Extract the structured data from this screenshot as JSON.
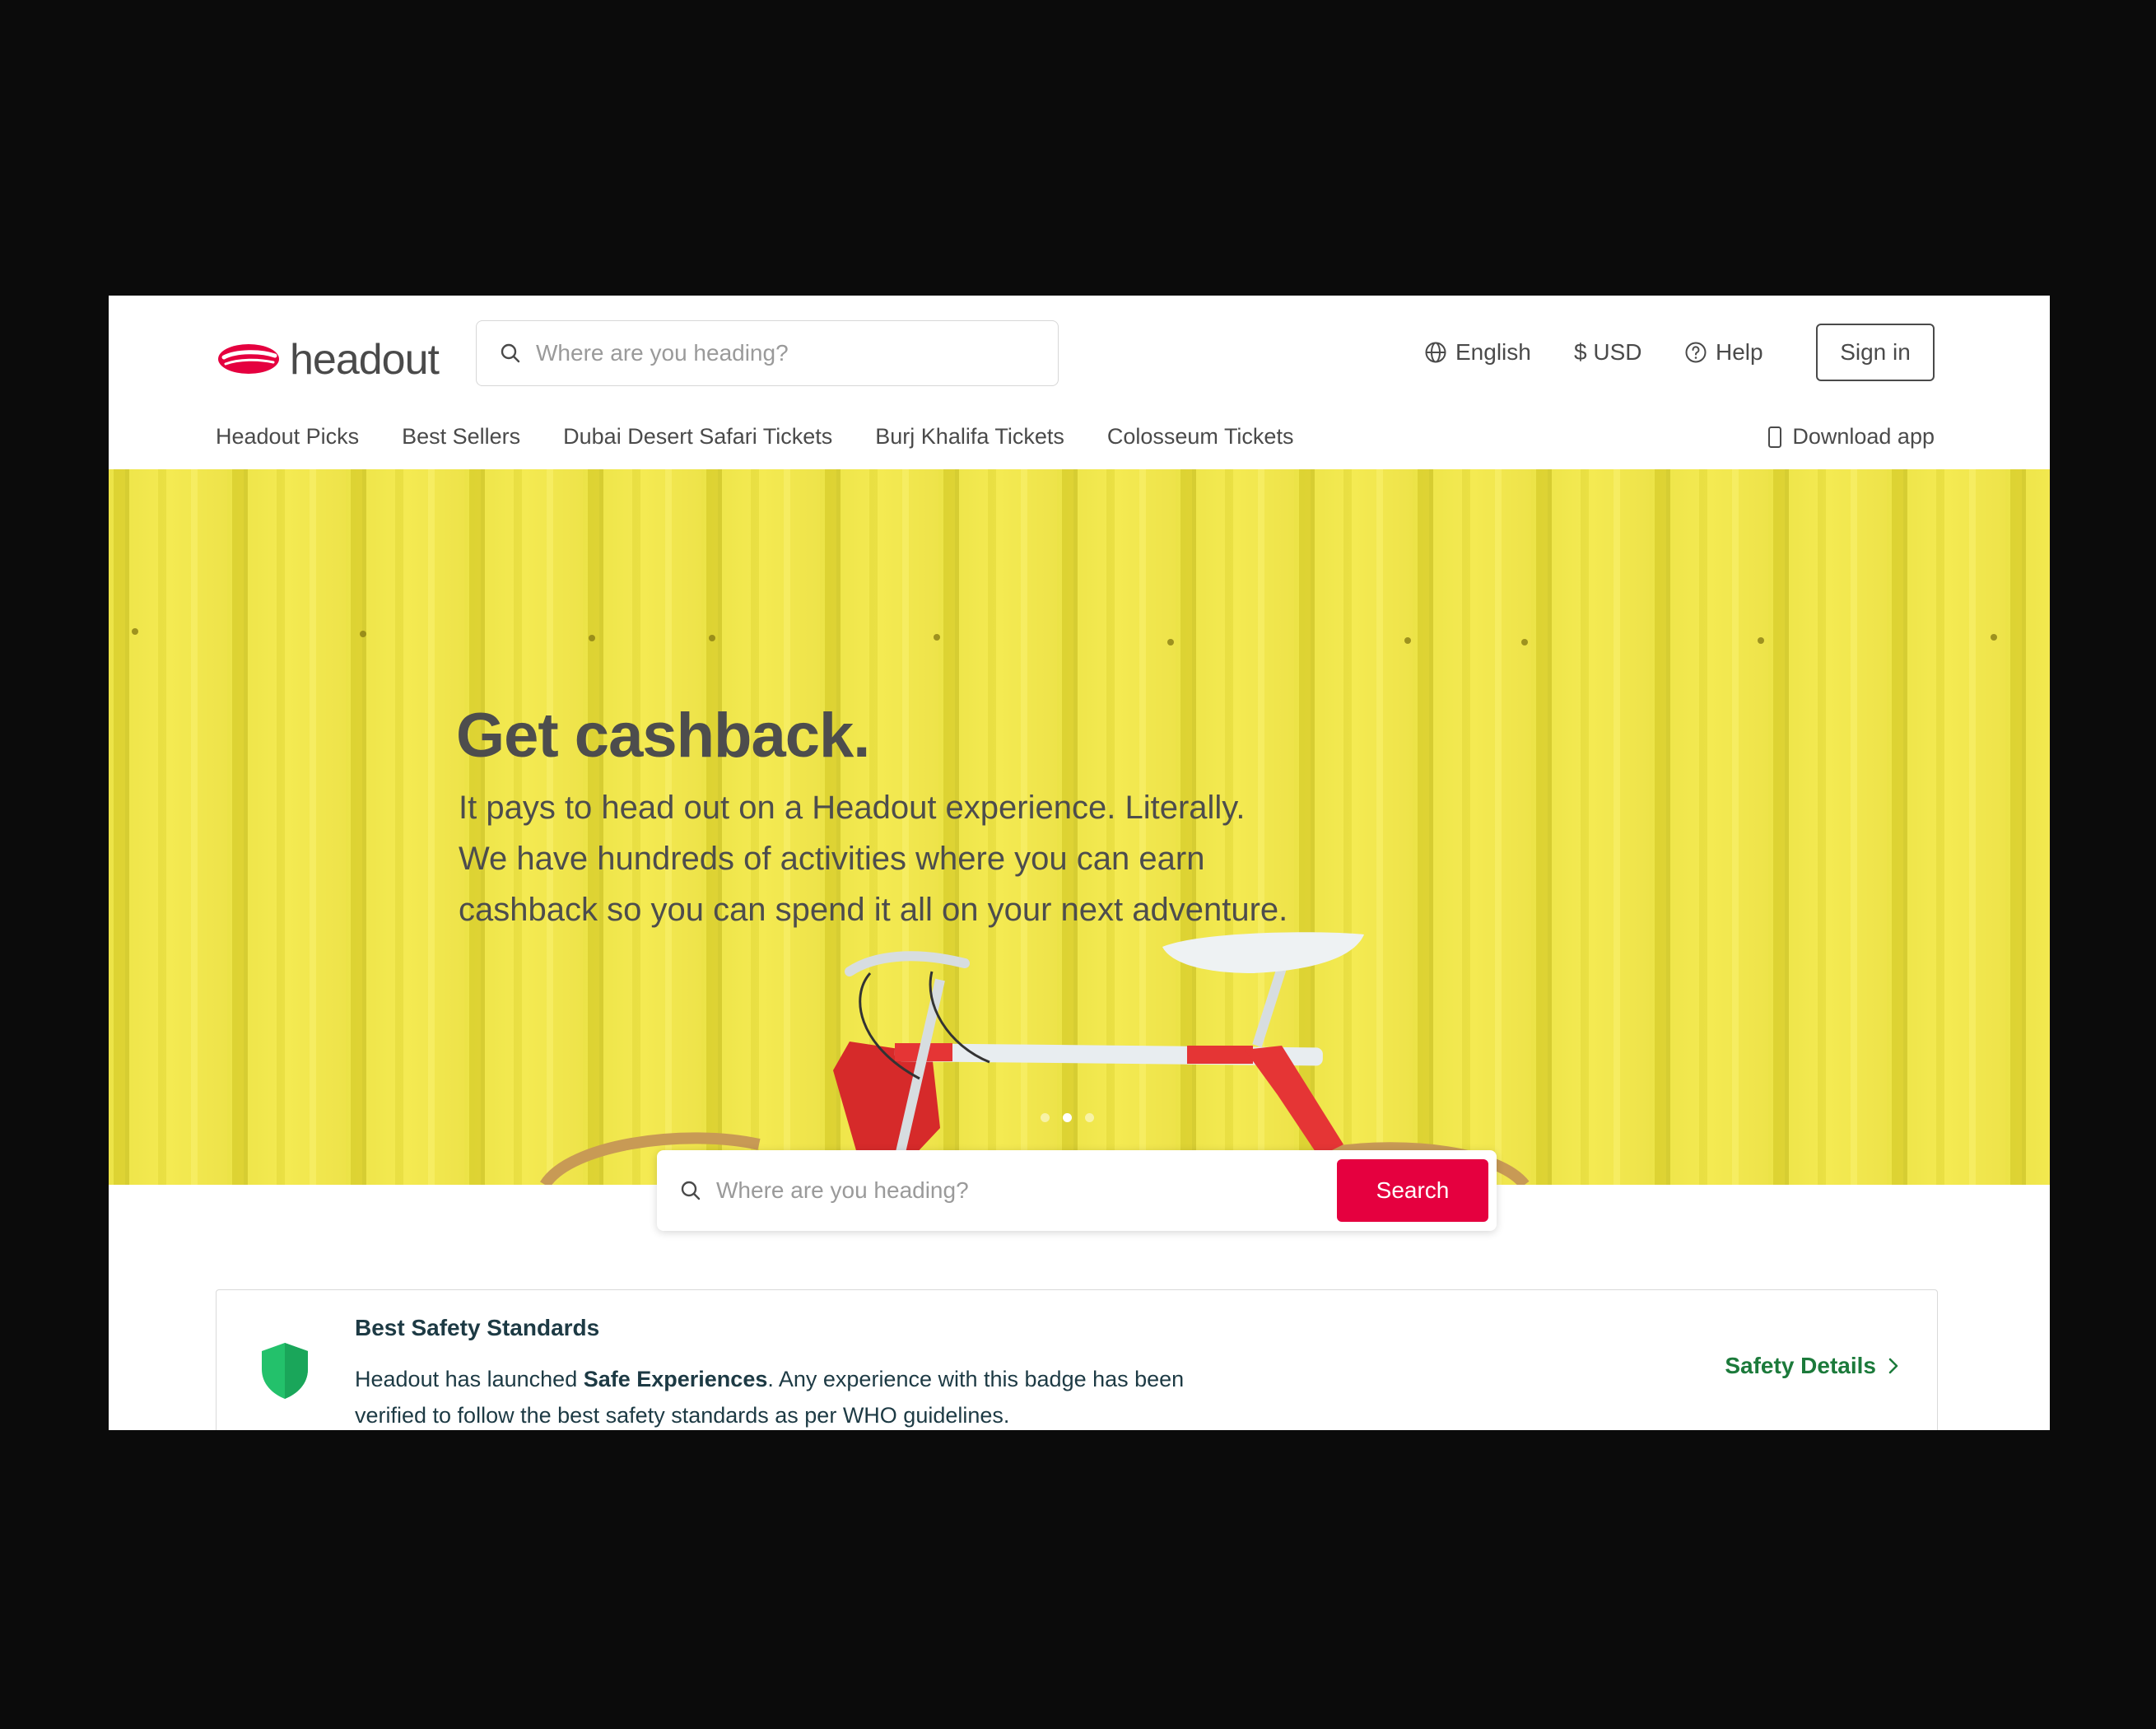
{
  "brand": {
    "name": "headout",
    "color": "#e5003f"
  },
  "header": {
    "search_placeholder": "Where are you heading?",
    "language": "English",
    "currency": "$ USD",
    "help": "Help",
    "sign_in": "Sign in",
    "download_app": "Download app"
  },
  "nav": {
    "items": [
      {
        "label": "Headout Picks"
      },
      {
        "label": "Best Sellers"
      },
      {
        "label": "Dubai Desert Safari Tickets"
      },
      {
        "label": "Burj Khalifa Tickets"
      },
      {
        "label": "Colosseum Tickets"
      }
    ]
  },
  "hero": {
    "title": "Get cashback.",
    "lines": [
      "It pays to head out on a Headout experience. Literally.",
      "We have hundreds of activities where you can earn",
      "cashback so you can spend it all on your next adventure."
    ],
    "background_color": "#f1e64a",
    "slides": {
      "count": 3,
      "active_index": 1
    },
    "search_placeholder": "Where are you heading?",
    "search_button": "Search"
  },
  "safety": {
    "title": "Best Safety Standards",
    "text_before": "Headout has launched ",
    "text_bold": "Safe Experiences",
    "text_after": ". Any experience with this badge has been",
    "text_line2": "verified to follow the best safety standards as per WHO guidelines.",
    "link": "Safety Details",
    "shield_color": "#23c16b",
    "link_color": "#1c7a3b"
  }
}
